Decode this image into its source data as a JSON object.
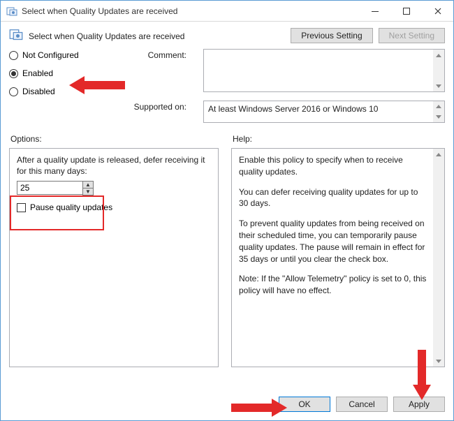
{
  "window": {
    "title": "Select when Quality Updates are received"
  },
  "header": {
    "policy_title": "Select when Quality Updates are received",
    "prev_btn": "Previous Setting",
    "next_btn": "Next Setting"
  },
  "radios": {
    "not_configured": "Not Configured",
    "enabled": "Enabled",
    "disabled": "Disabled",
    "selected": "enabled"
  },
  "labels": {
    "comment": "Comment:",
    "supported_on": "Supported on:",
    "options": "Options:",
    "help": "Help:"
  },
  "supported_text": "At least Windows Server 2016 or Windows 10",
  "options": {
    "defer_label": "After a quality update is released, defer receiving it for this many days:",
    "defer_value": "25",
    "pause_label": "Pause quality updates",
    "pause_checked": false
  },
  "help": {
    "p1": "Enable this policy to specify when to receive quality updates.",
    "p2": "You can defer receiving quality updates for up to 30 days.",
    "p3": "To prevent quality updates from being received on their scheduled time, you can temporarily pause quality updates. The pause will remain in effect for 35 days or until you clear the check box.",
    "p4": "Note: If the \"Allow Telemetry\" policy is set to 0, this policy will have no effect."
  },
  "footer": {
    "ok": "OK",
    "cancel": "Cancel",
    "apply": "Apply"
  }
}
